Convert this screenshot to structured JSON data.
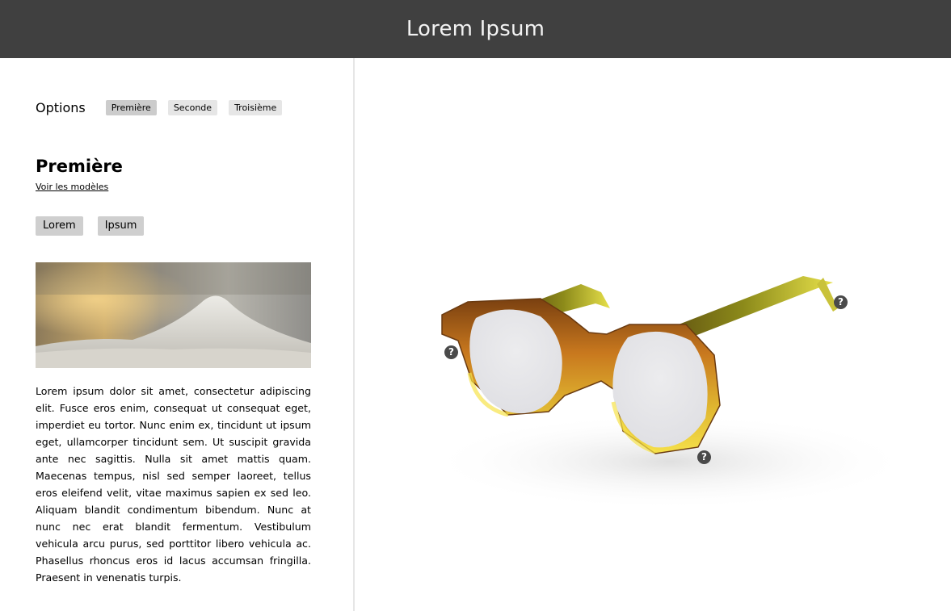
{
  "header": {
    "title": "Lorem Ipsum"
  },
  "options": {
    "label": "Options",
    "chips": [
      "Première",
      "Seconde",
      "Troisième"
    ]
  },
  "section": {
    "title": "Première",
    "link": "Voir les modèles",
    "buttons": [
      "Lorem",
      "Ipsum"
    ],
    "description": "Lorem ipsum dolor sit amet, consectetur adipiscing elit. Fusce eros enim, consequat ut consequat eget, imperdiet eu tortor. Nunc enim ex, tincidunt ut ipsum eget, ullamcorper tincidunt sem. Ut suscipit gravida ante nec sagittis. Nulla sit amet mattis quam. Maecenas tempus, nisl sed semper laoreet, tellus eros eleifend velit, vitae maximus sapien ex sed leo. Aliquam blandit condimentum bibendum. Nunc at nunc nec erat blandit fermentum. Vestibulum vehicula arcu purus, sed porttitor libero vehicula ac. Phasellus rhoncus eros id lacus accumsan fringilla. Praesent in venenatis turpis."
  },
  "viewer": {
    "help_marker": "?"
  },
  "colors": {
    "header_bg": "#404040",
    "chip_active": "#cccccc",
    "chip": "#e6e6e6"
  }
}
